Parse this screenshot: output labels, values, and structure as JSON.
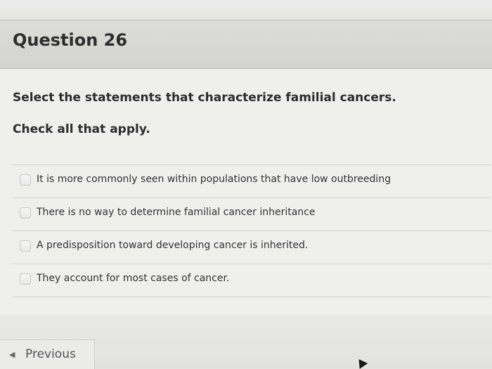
{
  "question": {
    "title": "Question 26",
    "prompt": "Select the statements that characterize familial cancers.",
    "instruction": "Check all that apply."
  },
  "answers": [
    {
      "label": "It is more commonly seen within populations that have low outbreeding",
      "checked": false
    },
    {
      "label": "There is no way to determine familial cancer inheritance",
      "checked": false
    },
    {
      "label": "A predisposition toward developing cancer is inherited.",
      "checked": false
    },
    {
      "label": "They account for most cases of cancer.",
      "checked": false
    }
  ],
  "navigation": {
    "previous_label": "Previous",
    "previous_icon": "chevron-left-icon"
  },
  "colors": {
    "header_bg": "#d6d6d2",
    "card_bg": "#efefec",
    "text": "#2d2d2d"
  }
}
